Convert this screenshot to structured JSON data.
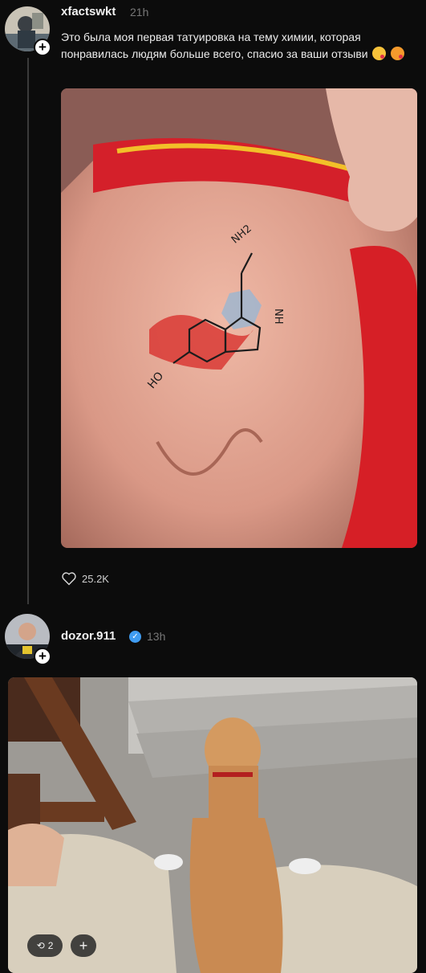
{
  "post1": {
    "username": "xfactswkt",
    "time": "21h",
    "text": "Это была моя первая татуировка на тему химии, которая понравилась людям больше всего, спасио за ваши отзыви",
    "likes": "25.2K",
    "tattoo_labels": {
      "nh2": "NH2",
      "nh": "NH",
      "oh": "HO"
    }
  },
  "post2": {
    "username": "dozor.911",
    "time": "13h",
    "repost_count": "2"
  },
  "icons": {
    "follow": "plus-icon",
    "like": "heart-icon",
    "verified": "verified-check-icon",
    "repost": "repost-icon"
  },
  "colors": {
    "background": "#0c0c0c",
    "verified": "#3f9cf2",
    "secondary_text": "#777777"
  }
}
